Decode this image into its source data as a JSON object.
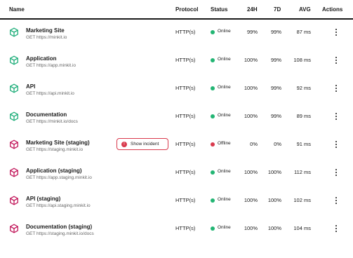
{
  "header": {
    "name": "Name",
    "protocol": "Protocol",
    "status": "Status",
    "h24": "24H",
    "d7": "7D",
    "avg": "AVG",
    "actions": "Actions"
  },
  "colors": {
    "online": "#22b573",
    "offline": "#d93a4d",
    "production_icon": "#1fae7a",
    "staging_icon": "#c2185b"
  },
  "monitors": [
    {
      "name": "Marketing Site",
      "url": "GET https://minkit.io",
      "protocol": "HTTP(s)",
      "status": "Online",
      "uptime_24h": "99%",
      "uptime_7d": "99%",
      "avg": "87 ms",
      "env": "production",
      "icon": "cube-icon"
    },
    {
      "name": "Application",
      "url": "GET https://app.minkit.io",
      "protocol": "HTTP(s)",
      "status": "Online",
      "uptime_24h": "100%",
      "uptime_7d": "99%",
      "avg": "108 ms",
      "env": "production",
      "icon": "cube-icon"
    },
    {
      "name": "API",
      "url": "GET https://api.minkit.io",
      "protocol": "HTTP(s)",
      "status": "Online",
      "uptime_24h": "100%",
      "uptime_7d": "99%",
      "avg": "92 ms",
      "env": "production",
      "icon": "cube-icon"
    },
    {
      "name": "Documentation",
      "url": "GET https://minkit.io/docs",
      "protocol": "HTTP(s)",
      "status": "Online",
      "uptime_24h": "100%",
      "uptime_7d": "99%",
      "avg": "89 ms",
      "env": "production",
      "icon": "cube-icon"
    },
    {
      "name": "Marketing Site (staging)",
      "url": "GET https://staging.minkit.io",
      "protocol": "HTTP(s)",
      "status": "Offline",
      "uptime_24h": "0%",
      "uptime_7d": "0%",
      "avg": "91 ms",
      "env": "staging",
      "icon": "cube-icon",
      "incident_button": "Show incident"
    },
    {
      "name": "Application (staging)",
      "url": "GET https://app.staging.minkit.io",
      "protocol": "HTTP(s)",
      "status": "Online",
      "uptime_24h": "100%",
      "uptime_7d": "100%",
      "avg": "112 ms",
      "env": "staging",
      "icon": "cube-icon"
    },
    {
      "name": "API (staging)",
      "url": "GET https://api.staging.minkit.io",
      "protocol": "HTTP(s)",
      "status": "Online",
      "uptime_24h": "100%",
      "uptime_7d": "100%",
      "avg": "102 ms",
      "env": "staging",
      "icon": "cube-icon"
    },
    {
      "name": "Documentation (staging)",
      "url": "GET https://staging.minkit.io/docs",
      "protocol": "HTTP(s)",
      "status": "Online",
      "uptime_24h": "100%",
      "uptime_7d": "100%",
      "avg": "104 ms",
      "env": "staging",
      "icon": "cube-icon"
    }
  ]
}
